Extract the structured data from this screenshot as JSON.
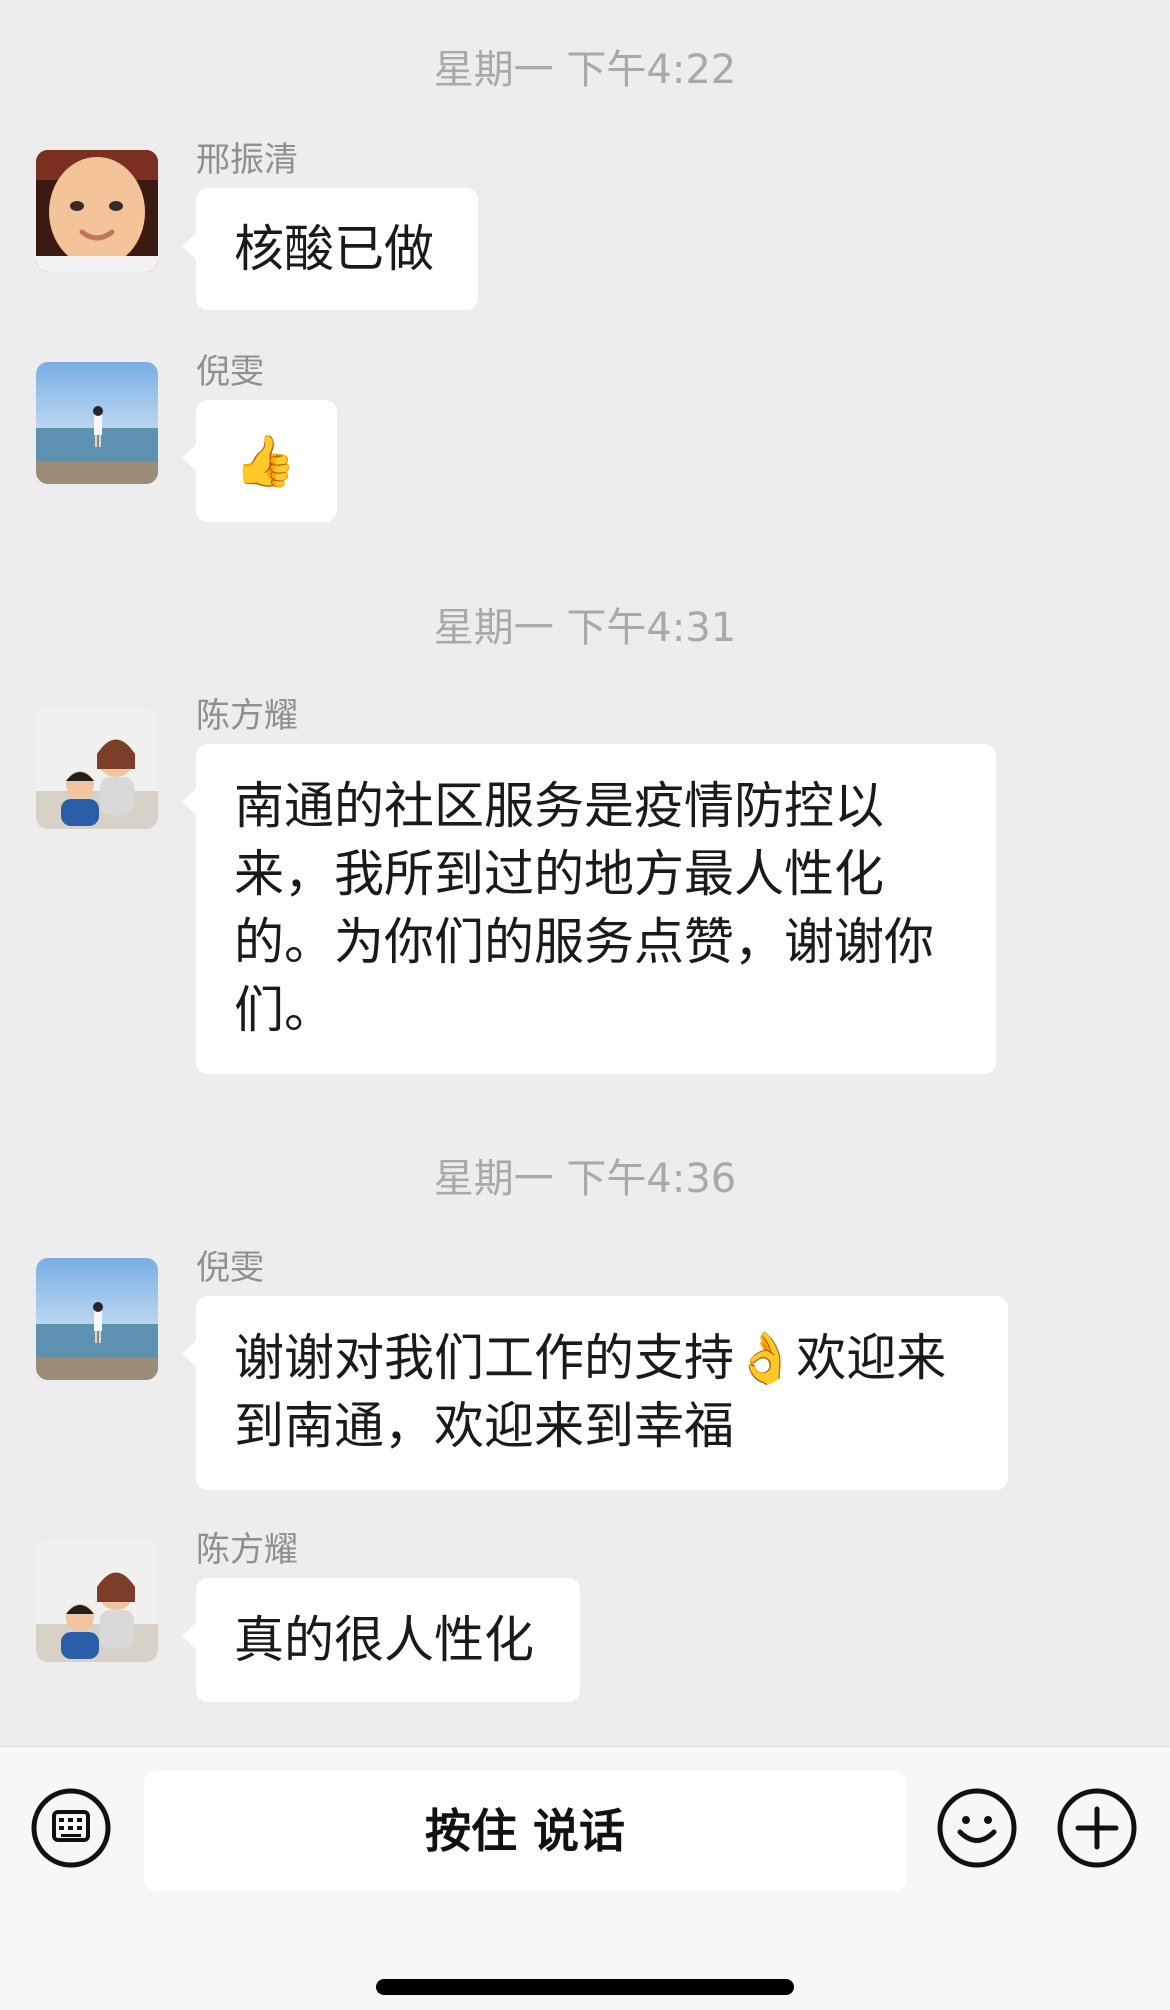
{
  "chat": {
    "messages": [
      {
        "time": "星期一 下午4:22",
        "sender": "邢振清",
        "avatar": "baby-avatar",
        "text": "核酸已做"
      },
      {
        "sender": "倪雯",
        "avatar": "beach-avatar",
        "text": "👍"
      },
      {
        "time": "星期一 下午4:31",
        "sender": "陈方耀",
        "avatar": "family-avatar",
        "text": "南通的社区服务是疫情防控以来，我所到过的地方最人性化的。为你们的服务点赞，谢谢你们。"
      },
      {
        "time": "星期一 下午4:36",
        "sender": "倪雯",
        "avatar": "beach-avatar",
        "text": "谢谢对我们工作的支持👌欢迎来到南通，欢迎来到幸福"
      },
      {
        "sender": "陈方耀",
        "avatar": "family-avatar",
        "text": "真的很人性化"
      }
    ]
  },
  "input_bar": {
    "voice_label": "按住 说话",
    "left_icon": "keyboard-icon",
    "right_icons": [
      "emoji-icon",
      "plus-icon"
    ]
  },
  "colors": {
    "background": "#ededed",
    "bubble": "#ffffff",
    "timestamp": "#a9a9a9",
    "sender_name": "#8f8f8f",
    "input_bar": "#f7f7f7"
  }
}
